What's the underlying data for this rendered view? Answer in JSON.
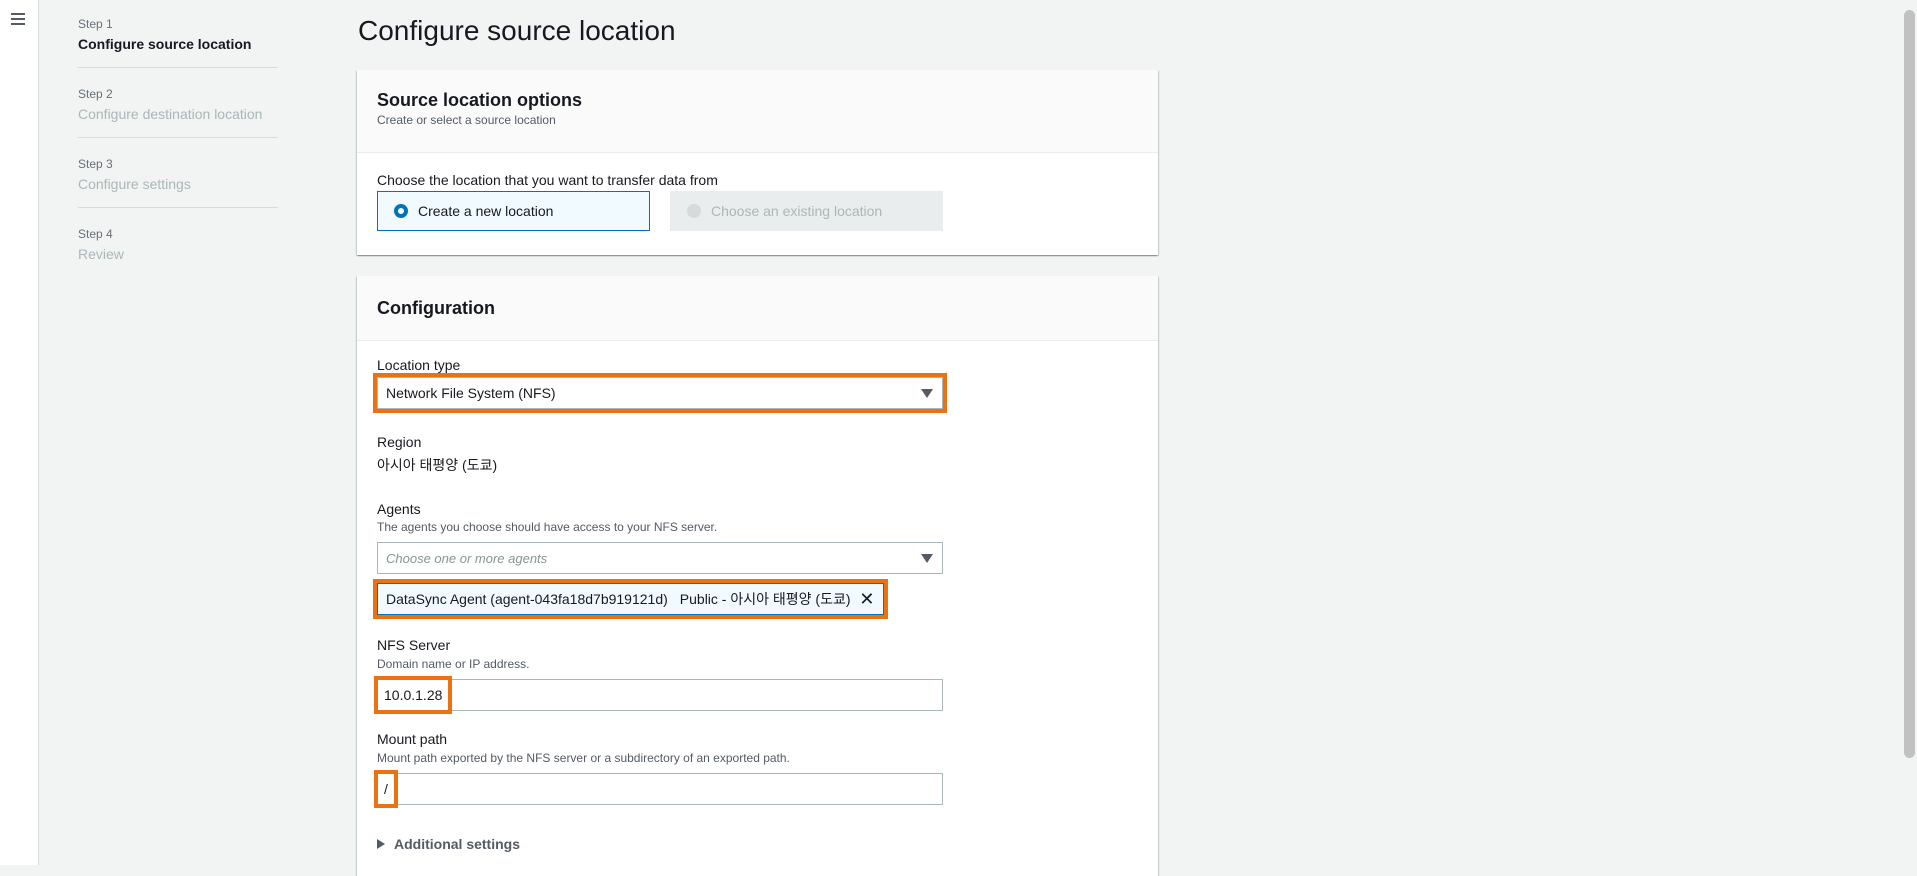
{
  "nav": {
    "menu_icon": "hamburger-menu-icon",
    "steps": [
      {
        "number": "Step 1",
        "title": "Configure source location",
        "active": true
      },
      {
        "number": "Step 2",
        "title": "Configure destination location",
        "active": false
      },
      {
        "number": "Step 3",
        "title": "Configure settings",
        "active": false
      },
      {
        "number": "Step 4",
        "title": "Review",
        "active": false
      }
    ]
  },
  "page": {
    "title": "Configure source location"
  },
  "source_options": {
    "title": "Source location options",
    "description": "Create or select a source location",
    "prompt": "Choose the location that you want to transfer data from",
    "create_new": "Create a new location",
    "choose_existing": "Choose an existing location"
  },
  "configuration": {
    "title": "Configuration",
    "location_type_label": "Location type",
    "location_type_value": "Network File System (NFS)",
    "region_label": "Region",
    "region_value": "아시아 태평양 (도쿄)",
    "agents_label": "Agents",
    "agents_desc": "The agents you choose should have access to your NFS server.",
    "agents_placeholder": "Choose one or more agents",
    "agent_token_name": "DataSync Agent (agent-043fa18d7b919121d)",
    "agent_token_detail": "Public - 아시아 태평양 (도쿄)",
    "nfs_label": "NFS Server",
    "nfs_desc": "Domain name or IP address.",
    "nfs_value": "10.0.1.28",
    "mount_label": "Mount path",
    "mount_desc": "Mount path exported by the NFS server or a subdirectory of an exported path.",
    "mount_value": "/",
    "additional": "Additional settings"
  },
  "colors": {
    "highlight": "#ec7211",
    "selected": "#0073bb"
  }
}
